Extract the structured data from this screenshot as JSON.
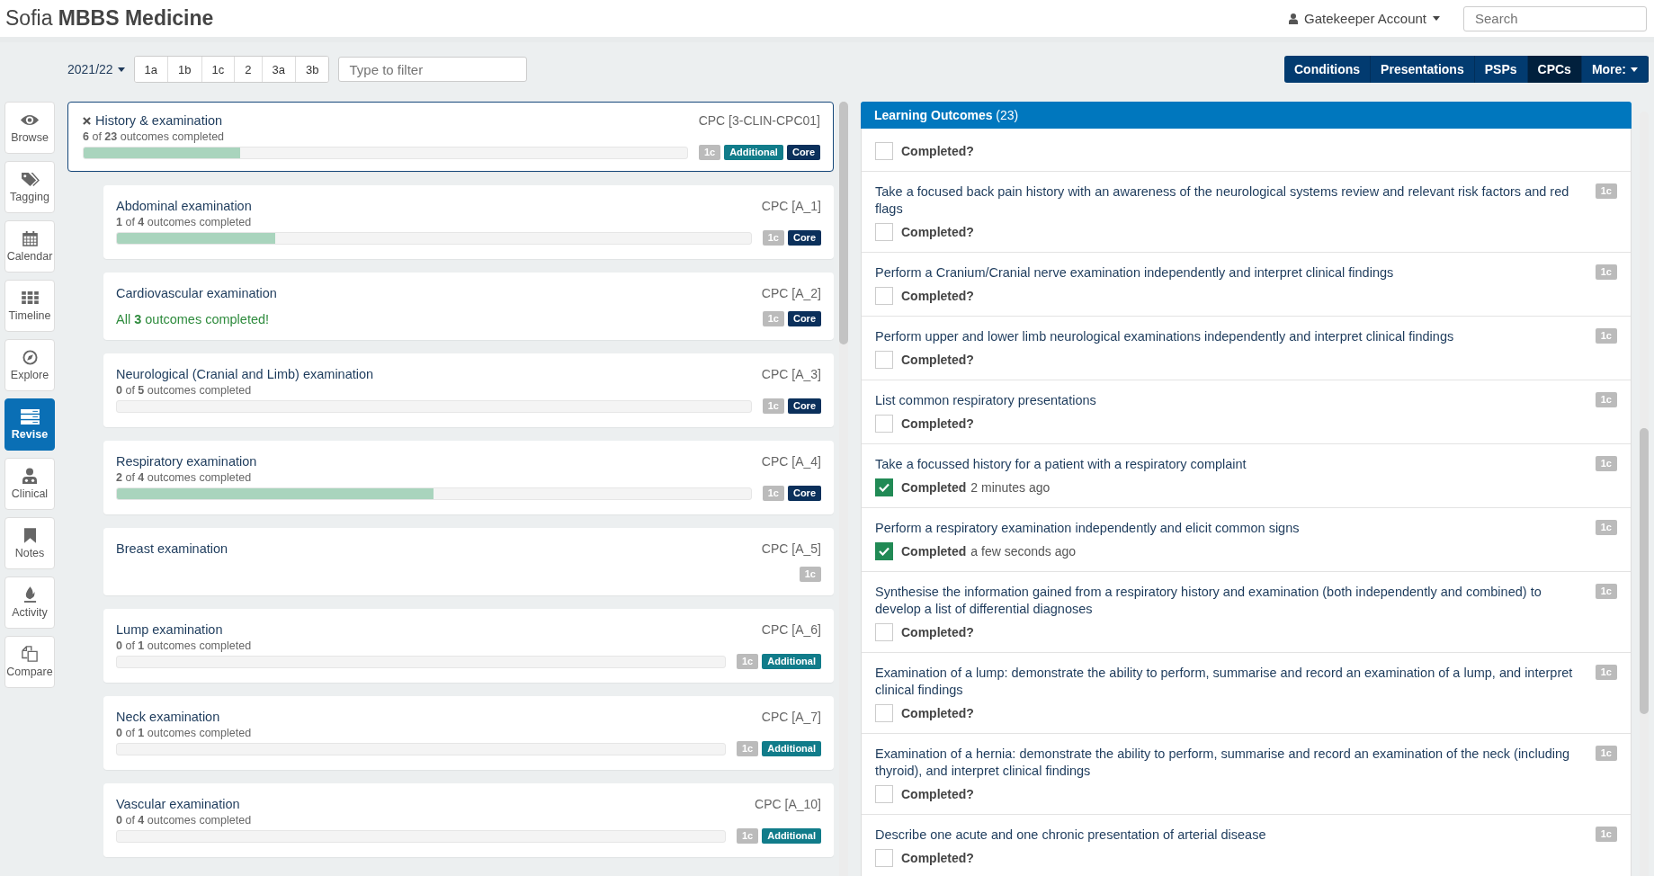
{
  "app": {
    "title": "Sofia **MBBS Medicine**",
    "account": "Gatekeeper Account",
    "search": {
      "placeholder": "Search"
    }
  },
  "toolbar": {
    "year": "2021/22",
    "years": [
      {
        "label": "1a",
        "selected": false
      },
      {
        "label": "1b",
        "selected": false
      },
      {
        "label": "1c",
        "selected": false
      },
      {
        "label": "2",
        "selected": false
      },
      {
        "label": "3a",
        "selected": false
      },
      {
        "label": "3b",
        "selected": false
      }
    ],
    "filter": {
      "placeholder": "Type to filter"
    },
    "nav": [
      {
        "label": "Conditions",
        "selected": false
      },
      {
        "label": "Presentations",
        "selected": false
      },
      {
        "label": "PSPs",
        "selected": false
      },
      {
        "label": "CPCs",
        "selected": true
      },
      {
        "label": "More:",
        "selected": false
      }
    ]
  },
  "sidebar": [
    {
      "label": "Browse",
      "selected": false
    },
    {
      "label": "Tagging",
      "selected": false
    },
    {
      "label": "Calendar",
      "selected": false
    },
    {
      "label": "Timeline",
      "selected": false
    },
    {
      "label": "Explore",
      "selected": false
    },
    {
      "label": "Revise",
      "selected": true
    },
    {
      "label": "Clinical",
      "selected": false
    },
    {
      "label": "Notes",
      "selected": false
    },
    {
      "label": "Activity",
      "selected": false
    },
    {
      "label": "Compare",
      "selected": false
    }
  ],
  "cpc": {
    "title": "History & examination",
    "code": "CPC [3-CLIN-CPC01]",
    "progress": "**6** of **23** outcomes completed",
    "level": 0.26,
    "tags": [
      {
        "label": "1c",
        "kind": "year"
      },
      {
        "label": "Additional",
        "kind": "additional"
      },
      {
        "label": "Core",
        "kind": "core"
      }
    ],
    "children": [
      {
        "title": "Abdominal examination",
        "code": "CPC [A_1]",
        "kind": "partial",
        "progress": "**1** of **4** outcomes completed",
        "level": 0.25,
        "tags": [
          {
            "label": "1c",
            "kind": "year"
          },
          {
            "label": "Core",
            "kind": "core"
          }
        ]
      },
      {
        "title": "Cardiovascular examination",
        "code": "CPC [A_2]",
        "kind": "done",
        "progress": "All **3** outcomes completed!",
        "tags": [
          {
            "label": "1c",
            "kind": "year"
          },
          {
            "label": "Core",
            "kind": "core"
          }
        ]
      },
      {
        "title": "Neurological (Cranial and Limb) examination",
        "code": "CPC [A_3]",
        "kind": "partial",
        "progress": "**0** of **5** outcomes completed",
        "level": 0,
        "tags": [
          {
            "label": "1c",
            "kind": "year"
          },
          {
            "label": "Core",
            "kind": "core"
          }
        ]
      },
      {
        "title": "Respiratory examination",
        "code": "CPC [A_4]",
        "kind": "partial",
        "progress": "**2** of **4** outcomes completed",
        "level": 0.5,
        "tags": [
          {
            "label": "1c",
            "kind": "year"
          },
          {
            "label": "Core",
            "kind": "core"
          }
        ]
      },
      {
        "title": "Breast examination",
        "code": "CPC [A_5]",
        "kind": "plain",
        "tags": [
          {
            "label": "1c",
            "kind": "year"
          }
        ]
      },
      {
        "title": "Lump examination",
        "code": "CPC [A_6]",
        "kind": "partial",
        "progress": "**0** of **1** outcomes completed",
        "level": 0,
        "tags": [
          {
            "label": "1c",
            "kind": "year"
          },
          {
            "label": "Additional",
            "kind": "additional"
          }
        ]
      },
      {
        "title": "Neck examination",
        "code": "CPC [A_7]",
        "kind": "partial",
        "progress": "**0** of **1** outcomes completed",
        "level": 0,
        "tags": [
          {
            "label": "1c",
            "kind": "year"
          },
          {
            "label": "Additional",
            "kind": "additional"
          }
        ]
      },
      {
        "title": "Vascular examination",
        "code": "CPC [A_10]",
        "kind": "partial",
        "progress": "**0** of **4** outcomes completed",
        "level": 0,
        "tags": [
          {
            "label": "1c",
            "kind": "year"
          },
          {
            "label": "Additional",
            "kind": "additional"
          }
        ]
      }
    ]
  },
  "outcomes": {
    "title": "**Learning Outcomes** (23)",
    "items": [
      {
        "label": "Completed?",
        "checked": false
      },
      {
        "text": "Take a focused back pain history with an awareness of the neurological systems review and relevant risk factors and red flags",
        "tag": "1c",
        "label": "Completed?",
        "checked": false
      },
      {
        "text": "Perform a Cranium/Cranial nerve examination independently and interpret clinical findings",
        "tag": "1c",
        "label": "Completed?",
        "checked": false
      },
      {
        "text": "Perform upper and lower limb neurological examinations independently and interpret clinical findings",
        "tag": "1c",
        "label": "Completed?",
        "checked": false
      },
      {
        "text": "List common respiratory presentations",
        "tag": "1c",
        "label": "Completed?",
        "checked": false
      },
      {
        "text": "Take a focussed history for a patient with a respiratory complaint",
        "tag": "1c",
        "label": "Completed",
        "time": "2 minutes ago",
        "checked": true
      },
      {
        "text": "Perform a respiratory examination independently and elicit common signs",
        "tag": "1c",
        "label": "Completed",
        "time": "a few seconds ago",
        "checked": true
      },
      {
        "text": "Synthesise the information gained from a respiratory history and examination (both independently and combined) to develop a list of differential diagnoses",
        "tag": "1c",
        "label": "Completed?",
        "checked": false
      },
      {
        "text": "Examination of a lump: demonstrate the ability to perform, summarise and record an examination of a lump, and interpret clinical findings",
        "tag": "1c",
        "label": "Completed?",
        "checked": false
      },
      {
        "text": "Examination of a hernia: demonstrate the ability to perform, summarise and record an examination of the neck (including thyroid), and interpret clinical findings",
        "tag": "1c",
        "label": "Completed?",
        "checked": false
      },
      {
        "text": "Describe one acute and one chronic presentation of arterial disease",
        "tag": "1c",
        "label": "Completed?",
        "checked": false
      }
    ]
  }
}
